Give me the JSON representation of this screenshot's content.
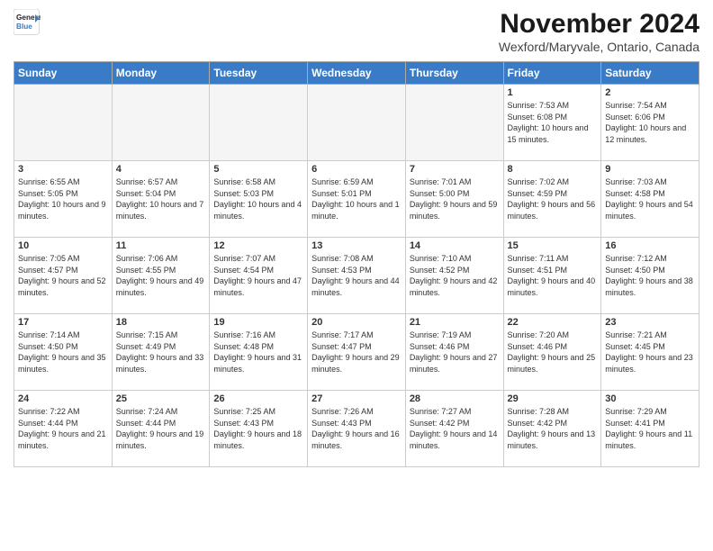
{
  "header": {
    "logo_line1": "General",
    "logo_line2": "Blue",
    "month_title": "November 2024",
    "location": "Wexford/Maryvale, Ontario, Canada"
  },
  "weekdays": [
    "Sunday",
    "Monday",
    "Tuesday",
    "Wednesday",
    "Thursday",
    "Friday",
    "Saturday"
  ],
  "weeks": [
    [
      {
        "day": "",
        "info": ""
      },
      {
        "day": "",
        "info": ""
      },
      {
        "day": "",
        "info": ""
      },
      {
        "day": "",
        "info": ""
      },
      {
        "day": "",
        "info": ""
      },
      {
        "day": "1",
        "info": "Sunrise: 7:53 AM\nSunset: 6:08 PM\nDaylight: 10 hours and 15 minutes."
      },
      {
        "day": "2",
        "info": "Sunrise: 7:54 AM\nSunset: 6:06 PM\nDaylight: 10 hours and 12 minutes."
      }
    ],
    [
      {
        "day": "3",
        "info": "Sunrise: 6:55 AM\nSunset: 5:05 PM\nDaylight: 10 hours and 9 minutes."
      },
      {
        "day": "4",
        "info": "Sunrise: 6:57 AM\nSunset: 5:04 PM\nDaylight: 10 hours and 7 minutes."
      },
      {
        "day": "5",
        "info": "Sunrise: 6:58 AM\nSunset: 5:03 PM\nDaylight: 10 hours and 4 minutes."
      },
      {
        "day": "6",
        "info": "Sunrise: 6:59 AM\nSunset: 5:01 PM\nDaylight: 10 hours and 1 minute."
      },
      {
        "day": "7",
        "info": "Sunrise: 7:01 AM\nSunset: 5:00 PM\nDaylight: 9 hours and 59 minutes."
      },
      {
        "day": "8",
        "info": "Sunrise: 7:02 AM\nSunset: 4:59 PM\nDaylight: 9 hours and 56 minutes."
      },
      {
        "day": "9",
        "info": "Sunrise: 7:03 AM\nSunset: 4:58 PM\nDaylight: 9 hours and 54 minutes."
      }
    ],
    [
      {
        "day": "10",
        "info": "Sunrise: 7:05 AM\nSunset: 4:57 PM\nDaylight: 9 hours and 52 minutes."
      },
      {
        "day": "11",
        "info": "Sunrise: 7:06 AM\nSunset: 4:55 PM\nDaylight: 9 hours and 49 minutes."
      },
      {
        "day": "12",
        "info": "Sunrise: 7:07 AM\nSunset: 4:54 PM\nDaylight: 9 hours and 47 minutes."
      },
      {
        "day": "13",
        "info": "Sunrise: 7:08 AM\nSunset: 4:53 PM\nDaylight: 9 hours and 44 minutes."
      },
      {
        "day": "14",
        "info": "Sunrise: 7:10 AM\nSunset: 4:52 PM\nDaylight: 9 hours and 42 minutes."
      },
      {
        "day": "15",
        "info": "Sunrise: 7:11 AM\nSunset: 4:51 PM\nDaylight: 9 hours and 40 minutes."
      },
      {
        "day": "16",
        "info": "Sunrise: 7:12 AM\nSunset: 4:50 PM\nDaylight: 9 hours and 38 minutes."
      }
    ],
    [
      {
        "day": "17",
        "info": "Sunrise: 7:14 AM\nSunset: 4:50 PM\nDaylight: 9 hours and 35 minutes."
      },
      {
        "day": "18",
        "info": "Sunrise: 7:15 AM\nSunset: 4:49 PM\nDaylight: 9 hours and 33 minutes."
      },
      {
        "day": "19",
        "info": "Sunrise: 7:16 AM\nSunset: 4:48 PM\nDaylight: 9 hours and 31 minutes."
      },
      {
        "day": "20",
        "info": "Sunrise: 7:17 AM\nSunset: 4:47 PM\nDaylight: 9 hours and 29 minutes."
      },
      {
        "day": "21",
        "info": "Sunrise: 7:19 AM\nSunset: 4:46 PM\nDaylight: 9 hours and 27 minutes."
      },
      {
        "day": "22",
        "info": "Sunrise: 7:20 AM\nSunset: 4:46 PM\nDaylight: 9 hours and 25 minutes."
      },
      {
        "day": "23",
        "info": "Sunrise: 7:21 AM\nSunset: 4:45 PM\nDaylight: 9 hours and 23 minutes."
      }
    ],
    [
      {
        "day": "24",
        "info": "Sunrise: 7:22 AM\nSunset: 4:44 PM\nDaylight: 9 hours and 21 minutes."
      },
      {
        "day": "25",
        "info": "Sunrise: 7:24 AM\nSunset: 4:44 PM\nDaylight: 9 hours and 19 minutes."
      },
      {
        "day": "26",
        "info": "Sunrise: 7:25 AM\nSunset: 4:43 PM\nDaylight: 9 hours and 18 minutes."
      },
      {
        "day": "27",
        "info": "Sunrise: 7:26 AM\nSunset: 4:43 PM\nDaylight: 9 hours and 16 minutes."
      },
      {
        "day": "28",
        "info": "Sunrise: 7:27 AM\nSunset: 4:42 PM\nDaylight: 9 hours and 14 minutes."
      },
      {
        "day": "29",
        "info": "Sunrise: 7:28 AM\nSunset: 4:42 PM\nDaylight: 9 hours and 13 minutes."
      },
      {
        "day": "30",
        "info": "Sunrise: 7:29 AM\nSunset: 4:41 PM\nDaylight: 9 hours and 11 minutes."
      }
    ]
  ]
}
